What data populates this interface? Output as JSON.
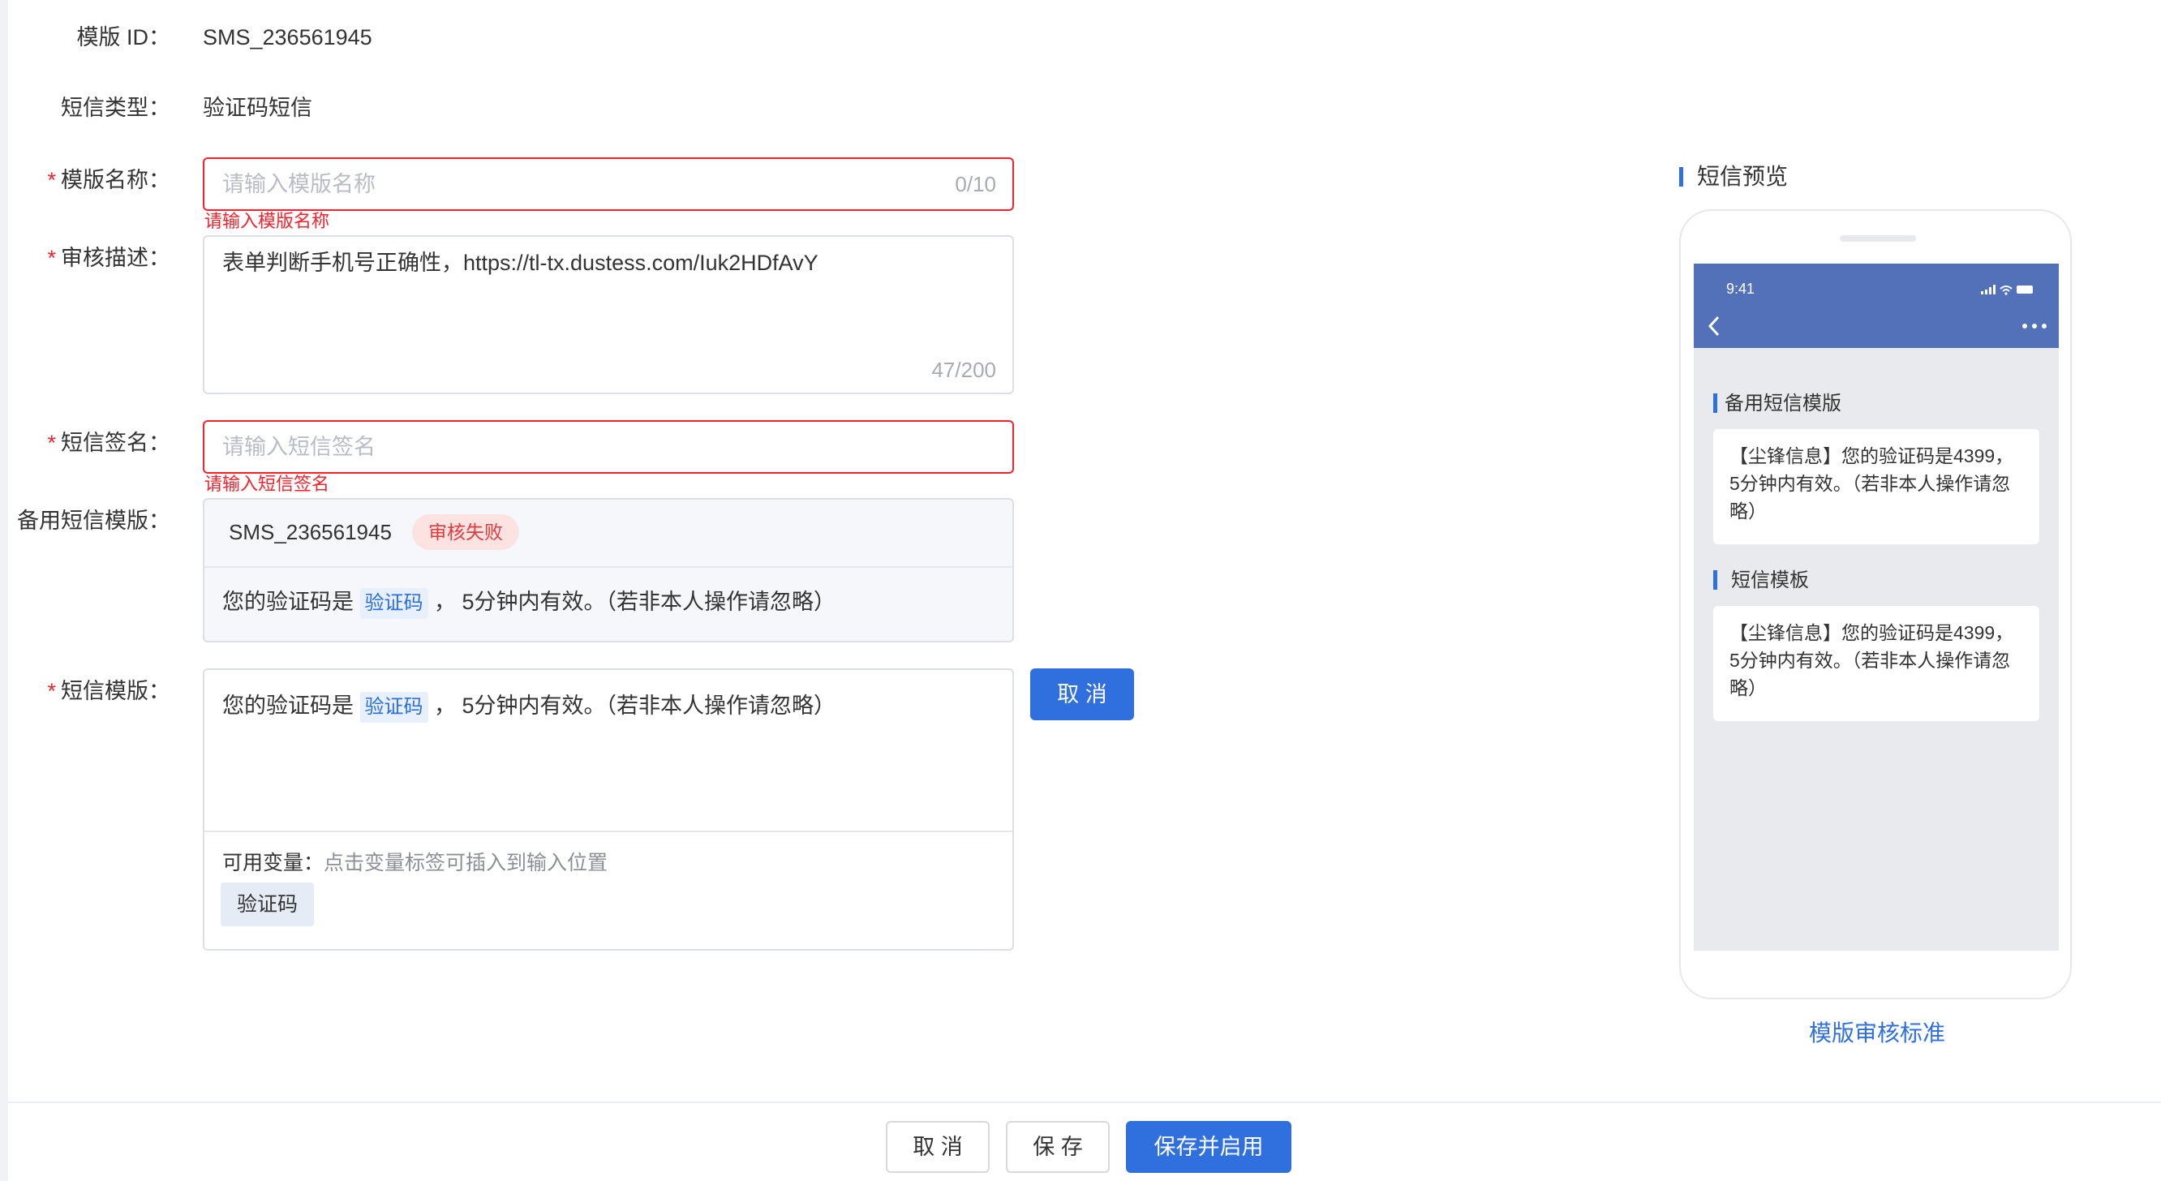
{
  "form": {
    "template_id_label": "模版 ID：",
    "template_id_value": "SMS_236561945",
    "sms_type_label": "短信类型：",
    "sms_type_value": "验证码短信",
    "name_label": "模版名称：",
    "name_placeholder": "请输入模版名称",
    "name_counter": "0/10",
    "name_error": "请输入模版名称",
    "desc_label": "审核描述：",
    "desc_value": "表单判断手机号正确性，https://tl-tx.dustess.com/Iuk2HDfAvY",
    "desc_counter": "47/200",
    "sign_label": "短信签名：",
    "sign_placeholder": "请输入短信签名",
    "sign_error": "请输入短信签名",
    "backup_label": "备用短信模版：",
    "backup_id": "SMS_236561945",
    "backup_status": "审核失败",
    "backup_content_prefix": "您的验证码是",
    "backup_content_var": "验证码",
    "backup_content_suffix": "，  5分钟内有效。（若非本人操作请忽略）",
    "tpl_label": "短信模版：",
    "tpl_content_prefix": "您的验证码是",
    "tpl_content_var": "验证码",
    "tpl_content_suffix": "，  5分钟内有效。（若非本人操作请忽略）",
    "vars_label": "可用变量：",
    "vars_hint": "点击变量标签可插入到输入位置",
    "var_chip": "验证码",
    "cancel_side": "取 消"
  },
  "preview": {
    "title": "短信预览",
    "time": "9:41",
    "backup_title": "备用短信模版",
    "backup_text": "【尘锋信息】您的验证码是4399，5分钟内有效。（若非本人操作请忽略）",
    "tpl_title": "短信模板",
    "tpl_text": "【尘锋信息】您的验证码是4399，5分钟内有效。（若非本人操作请忽略）",
    "standard_link": "模版审核标准"
  },
  "footer": {
    "cancel": "取 消",
    "save": "保 存",
    "save_enable": "保存并启用"
  },
  "colors": {
    "primary": "#2f6fde",
    "error": "#f5222d",
    "status_bar": "#5271b8"
  }
}
